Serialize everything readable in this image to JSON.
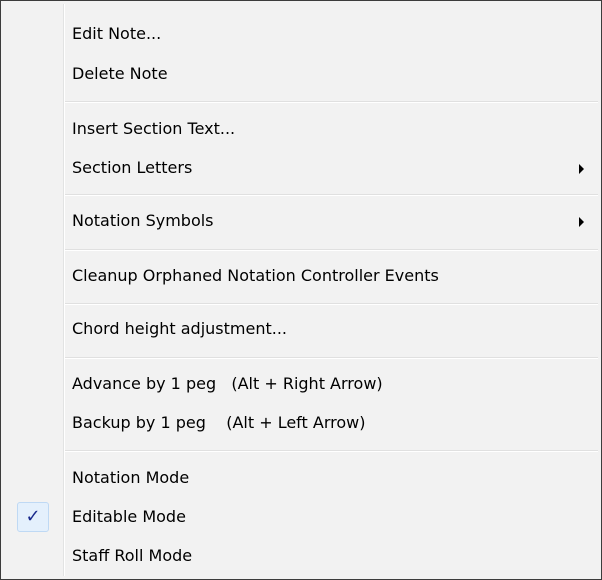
{
  "menu": {
    "items": {
      "edit_note": {
        "label": "Edit Note..."
      },
      "delete_note": {
        "label": "Delete Note"
      },
      "insert_section_text": {
        "label": "Insert Section Text..."
      },
      "section_letters": {
        "label": "Section Letters",
        "has_submenu": true
      },
      "notation_symbols": {
        "label": "Notation Symbols",
        "has_submenu": true
      },
      "cleanup_orphaned": {
        "label": "Cleanup Orphaned Notation Controller Events"
      },
      "chord_height": {
        "label": "Chord height adjustment..."
      },
      "advance_peg": {
        "label": "Advance by 1 peg   (Alt + Right Arrow)"
      },
      "backup_peg": {
        "label": "Backup by 1 peg    (Alt + Left Arrow)"
      },
      "notation_mode": {
        "label": "Notation Mode",
        "checked": false
      },
      "editable_mode": {
        "label": "Editable Mode",
        "checked": true,
        "check_glyph": "✓"
      },
      "staff_roll_mode": {
        "label": "Staff Roll Mode",
        "checked": false
      }
    },
    "colors": {
      "background": "#f2f2f2",
      "border": "#3c3c3c",
      "checkmark": "#1a2a8c",
      "check_highlight": "#e4f0fc"
    }
  }
}
